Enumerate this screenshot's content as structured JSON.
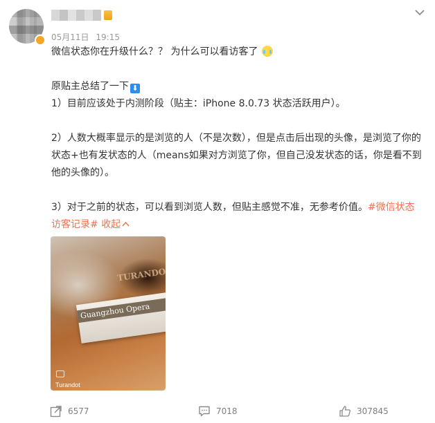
{
  "post": {
    "date": "05月11日",
    "time": "19:15",
    "paragraphs": {
      "p1": "微信状态你在升级什么？？ 为什么可以看访客了",
      "p2": "原贴主总结了一下",
      "p3": "1）目前应该处于内测阶段（贴主：iPhone 8.0.73 状态活跃用户）。",
      "p4": "2）人数大概率显示的是浏览的人（不是次数），但是点击后出现的头像，是浏览了你的状态+也有发状态的人（means如果对方浏览了你，但自己没发状态的话，你是看不到他的头像的）。",
      "p5_text": "3）对于之前的状态，可以看到浏览人数，但贴主感觉不准，无参考价值。",
      "p5_tag": "#微信状态 访客记录#",
      "p5_collapse": "收起"
    },
    "down_arrow": "⬇",
    "photo": {
      "caption": "Turandot",
      "ticket_text": "Guangzhou Opera",
      "poster_text": "TURANDOT"
    }
  },
  "actions": {
    "repost_count": "6577",
    "comment_count": "7018",
    "like_count": "307845"
  },
  "colors": {
    "link": "#eb7350",
    "text": "#333333",
    "meta": "#999999"
  },
  "icons": [
    "chevron-down-icon",
    "crying-emoji-icon",
    "down-arrow-icon",
    "repost-icon",
    "comment-icon",
    "like-icon"
  ]
}
